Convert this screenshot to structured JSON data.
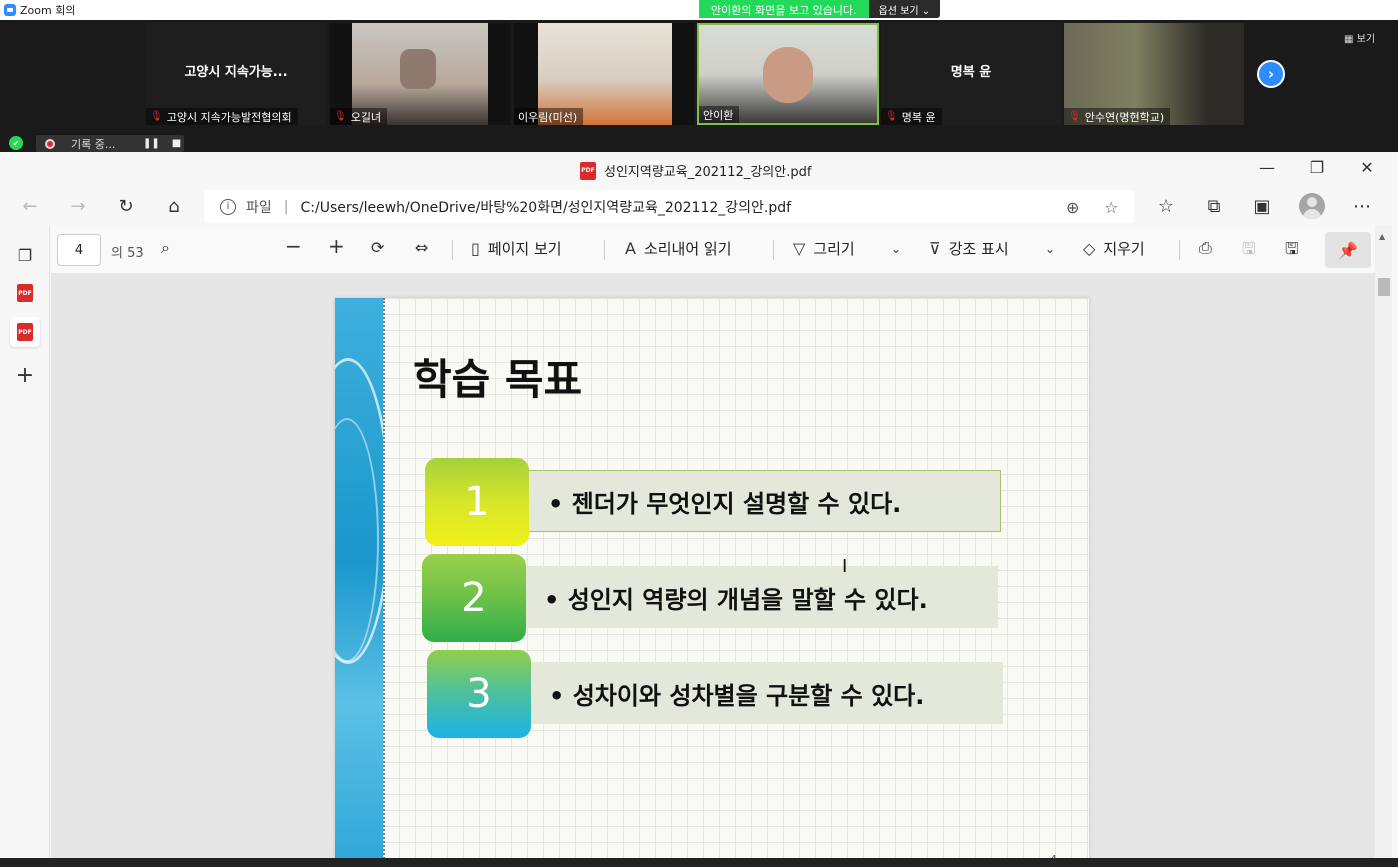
{
  "zoom": {
    "window_title": "Zoom 회의",
    "share_banner": "안이환의 화면을 보고 있습니다.",
    "options_label": "옵션 보기 ⌄",
    "view_label": "보기",
    "recording_label": "기록 중...",
    "participants": [
      {
        "name": "고양시 지속가능발전협의회",
        "center_name": "고양시 지속가능..."
      },
      {
        "name": "오길녀"
      },
      {
        "name": "이우림(미선)"
      },
      {
        "name": "안이환"
      },
      {
        "name": "명복 윤",
        "center_name": "명복 윤"
      },
      {
        "name": "안수연(명현학교)"
      }
    ]
  },
  "edge": {
    "tab_title": "성인지역량교육_202112_강의안.pdf",
    "address_scheme": "파일",
    "address_url": "C:/Users/leewh/OneDrive/바탕%20화면/성인지역량교육_202112_강의안.pdf"
  },
  "pdf_toolbar": {
    "page_current": "4",
    "page_total": "의 53",
    "page_view": "페이지 보기",
    "read_aloud": "소리내어 읽기",
    "draw": "그리기",
    "highlight": "강조 표시",
    "erase": "지우기"
  },
  "slide": {
    "title": "학습 목표",
    "page_number": "4",
    "goals": [
      {
        "num": "1",
        "text": "• 젠더가 무엇인지 설명할 수 있다.",
        "color_top": "#a6d13a",
        "color_bottom": "#f0f019"
      },
      {
        "num": "2",
        "text": "• 성인지 역량의 개념을 말할 수 있다.",
        "color_top": "#9bd04a",
        "color_bottom": "#2fae49"
      },
      {
        "num": "3",
        "text": "• 성차이와 성차별을 구분할 수 있다.",
        "color_top": "#8fcf4a",
        "color_bottom": "#1ab3e8"
      }
    ]
  }
}
